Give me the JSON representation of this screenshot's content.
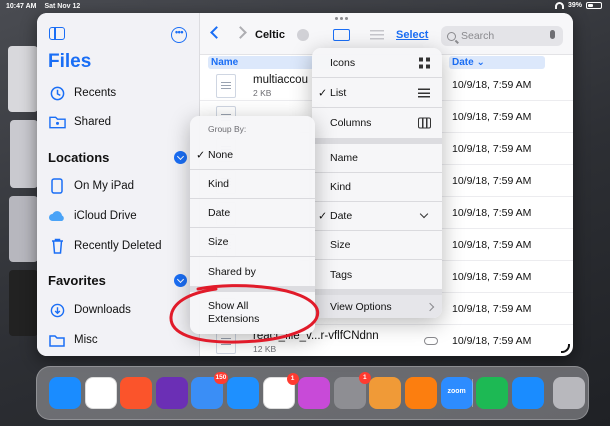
{
  "status_bar": {
    "time": "10:47 AM",
    "date": "Sat Nov 12",
    "battery": "39%",
    "battery_level": 0.39
  },
  "sidebar": {
    "title": "Files",
    "items_top": [
      {
        "label": "Recents",
        "icon": "clock-icon"
      },
      {
        "label": "Shared",
        "icon": "shared-folder-icon"
      }
    ],
    "locations_heading": "Locations",
    "locations": [
      {
        "label": "On My iPad",
        "icon": "ipad-icon"
      },
      {
        "label": "iCloud Drive",
        "icon": "cloud-icon"
      },
      {
        "label": "Recently Deleted",
        "icon": "trash-icon"
      }
    ],
    "favorites_heading": "Favorites",
    "favorites": [
      {
        "label": "Downloads",
        "icon": "download-icon"
      },
      {
        "label": "Misc",
        "icon": "folder-icon"
      }
    ]
  },
  "toolbar": {
    "folder_title": "Celtic",
    "select_label": "Select",
    "search_placeholder": "Search"
  },
  "columns": {
    "name": "Name",
    "date": "Date"
  },
  "files": [
    {
      "name": "multiaccou",
      "size": "2 KB",
      "date": "10/9/18, 7:59 AM"
    },
    {
      "name": "",
      "size": "",
      "date": "10/9/18, 7:59 AM"
    },
    {
      "name": "",
      "size": "",
      "date": "10/9/18, 7:59 AM"
    },
    {
      "name": "",
      "size": "",
      "date": "10/9/18, 7:59 AM"
    },
    {
      "name": "",
      "size": "",
      "date": "10/9/18, 7:59 AM"
    },
    {
      "name": "",
      "size": "",
      "date": "10/9/18, 7:59 AM"
    },
    {
      "name": "",
      "size": "",
      "date": "10/9/18, 7:59 AM"
    },
    {
      "name": "",
      "size": "",
      "date": "10/9/18, 7:59 AM"
    },
    {
      "name": "react_file_v...r-vflfCNdnn",
      "size": "12 KB",
      "date": "10/9/18, 7:59 AM"
    }
  ],
  "view_menu": {
    "view_modes": [
      "Icons",
      "List",
      "Columns"
    ],
    "selected_view": "List",
    "sort_by": [
      "Name",
      "Kind",
      "Date",
      "Size",
      "Tags"
    ],
    "selected_sort": "Date",
    "view_options": "View Options"
  },
  "group_menu": {
    "header": "Group By:",
    "options": [
      "None",
      "Kind",
      "Date",
      "Size",
      "Shared by"
    ],
    "selected": "None",
    "show_extensions": "Show All Extensions"
  },
  "dock": {
    "apps": [
      {
        "name": "safari-icon",
        "color": "#1a8cff"
      },
      {
        "name": "chrome-icon",
        "color": "#ffffff"
      },
      {
        "name": "brave-icon",
        "color": "#fb542b"
      },
      {
        "name": "tor-browser-icon",
        "color": "#6b2fb5"
      },
      {
        "name": "mail-icon",
        "color": "#3a8ef6",
        "badge": "150"
      },
      {
        "name": "files-icon",
        "color": "#1e90ff"
      },
      {
        "name": "photos-icon",
        "color": "#ffffff",
        "badge": "1"
      },
      {
        "name": "shortcuts-icon",
        "color": "#c84ad8"
      },
      {
        "name": "settings-icon",
        "color": "#8e8e93",
        "badge": "1"
      },
      {
        "name": "pages-icon",
        "color": "#f09a37"
      },
      {
        "name": "overcast-icon",
        "color": "#fc7e0f"
      },
      {
        "name": "zoom-icon",
        "color": "#2d8cff",
        "label": "zoom"
      },
      {
        "name": "spotify-icon",
        "color": "#1db954"
      },
      {
        "name": "safari-icon-2",
        "color": "#1a8cff"
      },
      {
        "name": "app-library-icon",
        "color": "#b8b8bd"
      }
    ]
  }
}
